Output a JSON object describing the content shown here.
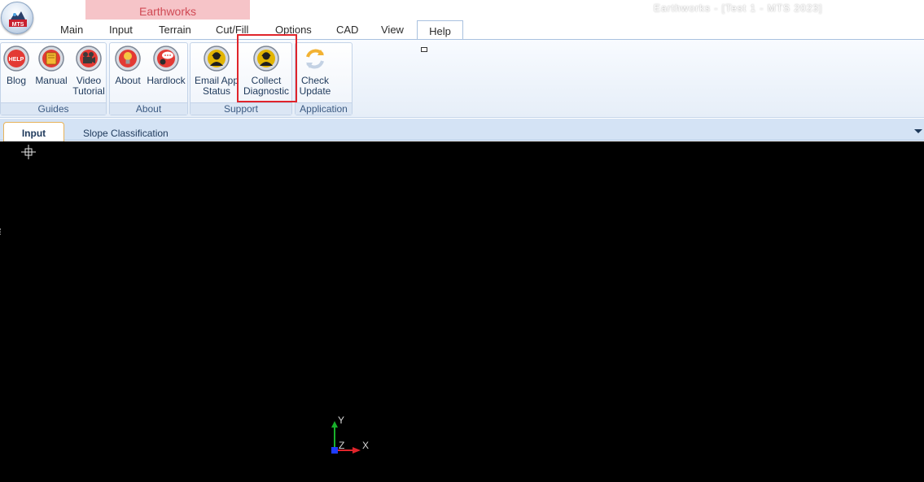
{
  "app": {
    "title_text": "Earthworks - [Test 1 - MTS 2023]",
    "logo_text": "MTS",
    "context_group_label": "Earthworks"
  },
  "ribbon_tabs": [
    "Main",
    "Input",
    "Terrain",
    "Cut/Fill",
    "Options",
    "CAD",
    "View",
    "Help"
  ],
  "active_tab": "Help",
  "ribbon_groups": {
    "guides": {
      "label": "Guides",
      "buttons": [
        {
          "label": "Blog",
          "icon": "help-blog-icon",
          "icon_text": "HELP"
        },
        {
          "label": "Manual",
          "icon": "manual-book-icon"
        },
        {
          "label": "Video Tutorial",
          "line1": "Video",
          "line2": "Tutorial",
          "icon": "video-camera-icon"
        }
      ]
    },
    "about": {
      "label": "About",
      "buttons": [
        {
          "label": "About",
          "icon": "lightbulb-icon"
        },
        {
          "label": "Hardlock",
          "icon": "hardlock-chat-icon"
        }
      ]
    },
    "support": {
      "label": "Support",
      "buttons": [
        {
          "label": "Email App Status",
          "line1": "Email App",
          "line2": "Status",
          "icon": "support-agent-icon"
        },
        {
          "label": "Collect Diagnostic",
          "line1": "Collect",
          "line2": "Diagnostic",
          "icon": "support-agent-icon"
        }
      ]
    },
    "application": {
      "label": "Application",
      "buttons": [
        {
          "label": "Check Update",
          "line1": "Check",
          "line2": "Update",
          "icon": "refresh-icon"
        }
      ]
    }
  },
  "document_tabs": [
    {
      "label": "Input",
      "active": true
    },
    {
      "label": "Slope Classification",
      "active": false
    }
  ],
  "viewport": {
    "background": "#000000",
    "ucs_axes": {
      "x": "X",
      "y": "Y",
      "z": "Z"
    }
  },
  "colors": {
    "context_group": "#f6c4c8",
    "context_label": "#d04a55",
    "highlight_box": "#e0242b",
    "ribbon_text": "#1e395b"
  }
}
